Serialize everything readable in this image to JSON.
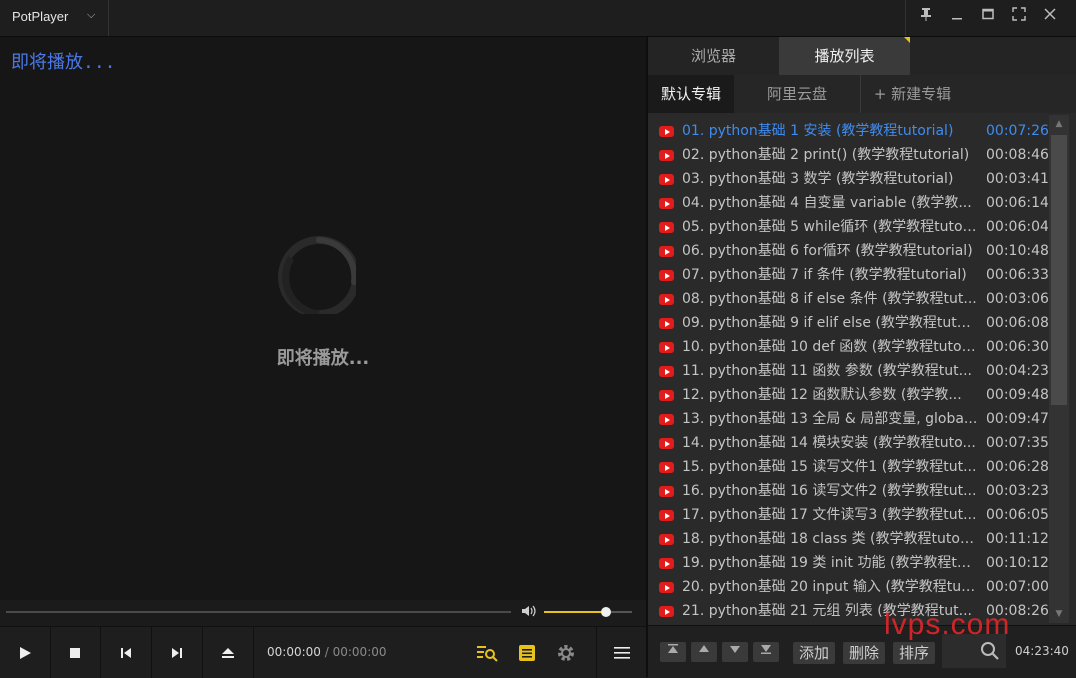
{
  "app": {
    "name": "PotPlayer",
    "caret": "⌵"
  },
  "window_buttons": {
    "pin": "📌",
    "minimize": "—",
    "maximize": "□",
    "fullscreen": "⛶",
    "close": "✕"
  },
  "video": {
    "osd_text": "即将播放...",
    "center_text": "即将播放..."
  },
  "volume": {
    "level": 0.7
  },
  "controls": {
    "current_time": "00:00:00",
    "separator": "/",
    "total_time": "00:00:00"
  },
  "playlist": {
    "tabs": [
      "浏览器",
      "播放列表"
    ],
    "active_tab": 1,
    "subtabs": [
      "默认专辑",
      "阿里云盘",
      "+ 新建专辑"
    ],
    "active_subtab": 0,
    "items": [
      {
        "title": "01. python基础 1 安装 (教学教程tutorial)",
        "duration": "00:07:26"
      },
      {
        "title": "02. python基础 2 print() (教学教程tutorial)",
        "duration": "00:08:46"
      },
      {
        "title": "03. python基础 3 数学 (教学教程tutorial)",
        "duration": "00:03:41"
      },
      {
        "title": "04. python基础 4 自变量 variable (教学教...",
        "duration": "00:06:14"
      },
      {
        "title": "05. python基础 5 while循环 (教学教程tutor...",
        "duration": "00:06:04"
      },
      {
        "title": "06. python基础 6 for循环 (教学教程tutorial)",
        "duration": "00:10:48"
      },
      {
        "title": "07. python基础 7 if 条件 (教学教程tutorial)",
        "duration": "00:06:33"
      },
      {
        "title": "08. python基础 8 if else 条件 (教学教程tut...",
        "duration": "00:03:06"
      },
      {
        "title": "09. python基础 9 if elif else (教学教程tutori...",
        "duration": "00:06:08"
      },
      {
        "title": "10. python基础 10 def 函数 (教学教程tutor...",
        "duration": "00:06:30"
      },
      {
        "title": "11. python基础 11 函数 参数 (教学教程tut...",
        "duration": "00:04:23"
      },
      {
        "title": "12. python基础 12 函数默认参数 (教学教...",
        "duration": "00:09:48"
      },
      {
        "title": "13. python基础 13 全局 & 局部变量, globa...",
        "duration": "00:09:47"
      },
      {
        "title": "14. python基础 14 模块安装 (教学教程tuto...",
        "duration": "00:07:35"
      },
      {
        "title": "15. python基础 15 读写文件1 (教学教程tut...",
        "duration": "00:06:28"
      },
      {
        "title": "16. python基础 16 读写文件2 (教学教程tut...",
        "duration": "00:03:23"
      },
      {
        "title": "17. python基础 17 文件读写3 (教学教程tut...",
        "duration": "00:06:05"
      },
      {
        "title": "18. python基础 18 class 类 (教学教程tutori...",
        "duration": "00:11:12"
      },
      {
        "title": "19. python基础 19 类 init 功能 (教学教程tut...",
        "duration": "00:10:12"
      },
      {
        "title": "20. python基础 20 input 输入 (教学教程tut...",
        "duration": "00:07:00"
      },
      {
        "title": "21. python基础 21 元组 列表 (教学教程tut...",
        "duration": "00:08:26"
      }
    ],
    "active_index": 0,
    "bottom": {
      "add_label": "添加",
      "delete_label": "删除",
      "sort_label": "排序",
      "total_duration": "04:23:40"
    },
    "watermark": "lvps.com"
  },
  "colors": {
    "accent_yellow": "#e8c21b",
    "active_item_blue": "#3f8cf0",
    "osd_blue": "#4b78e8",
    "youtube_red": "#e21b1b"
  }
}
